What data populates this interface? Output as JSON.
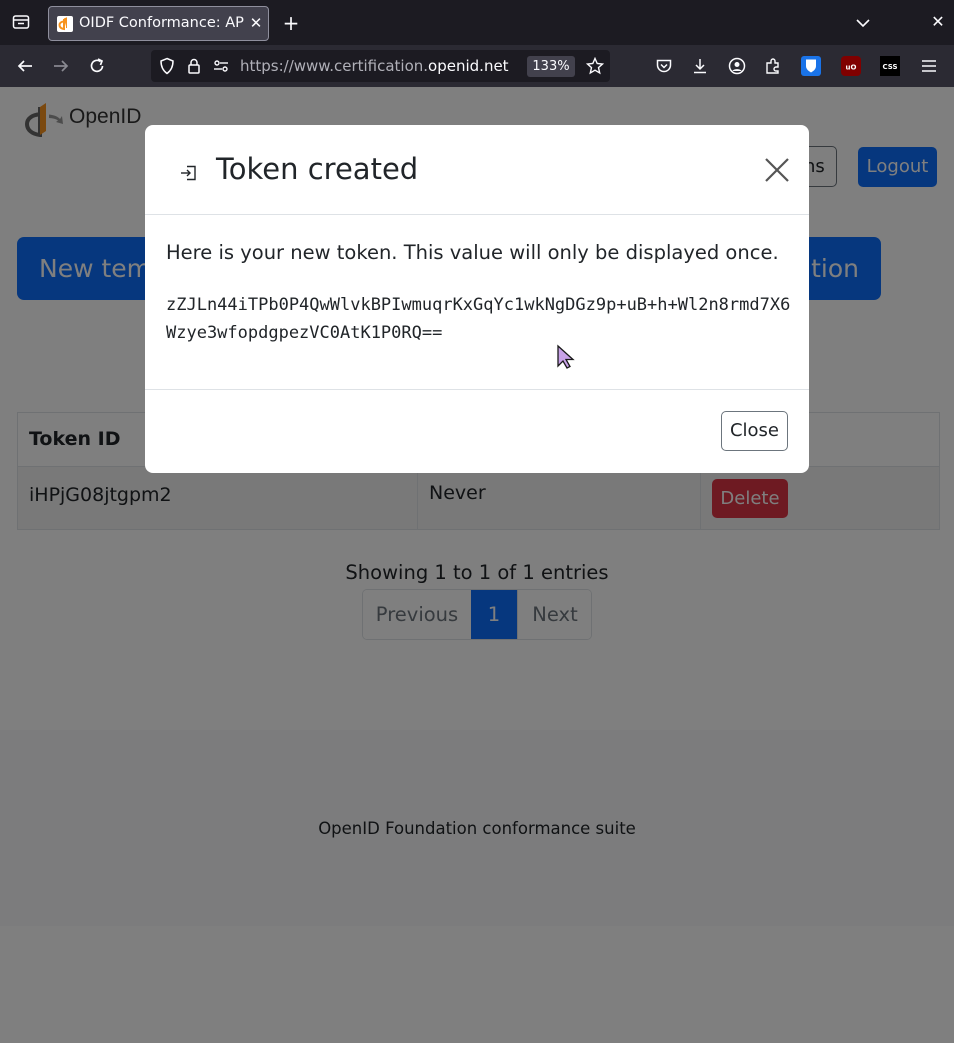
{
  "browser": {
    "tab_title": "OIDF Conformance: AP",
    "url_prefix": "https://www.certification.",
    "url_domain": "openid.net",
    "zoom": "133%"
  },
  "page": {
    "logo_text": "OpenID",
    "top_buttons": {
      "instructions_label_fragment": "ns",
      "logout_label": "Logout"
    },
    "new_template_left": "New temp",
    "new_template_right": "ntion",
    "table": {
      "headers": [
        "Token ID",
        "",
        ""
      ],
      "rows": [
        {
          "token_id": "iHPjG08jtgpm2",
          "expires": "Never",
          "action": "Delete"
        }
      ]
    },
    "showing": "Showing 1 to 1 of 1 entries",
    "pager": {
      "previous": "Previous",
      "current": "1",
      "next": "Next"
    },
    "footer": "OpenID Foundation conformance suite"
  },
  "modal": {
    "title": "Token created",
    "message": "Here is your new token. This value will only be displayed once.",
    "token": "zZJLn44iTPb0P4QwWlvkBPIwmuqrKxGqYc1wkNgDGz9p+uB+h+Wl2n8rmd7X6Wzye3wfopdgpezVC0AtK1P0RQ==",
    "close_label": "Close"
  },
  "colors": {
    "primary": "#0d6efd",
    "danger": "#dc3545",
    "browser_dark": "#1c1b22"
  }
}
